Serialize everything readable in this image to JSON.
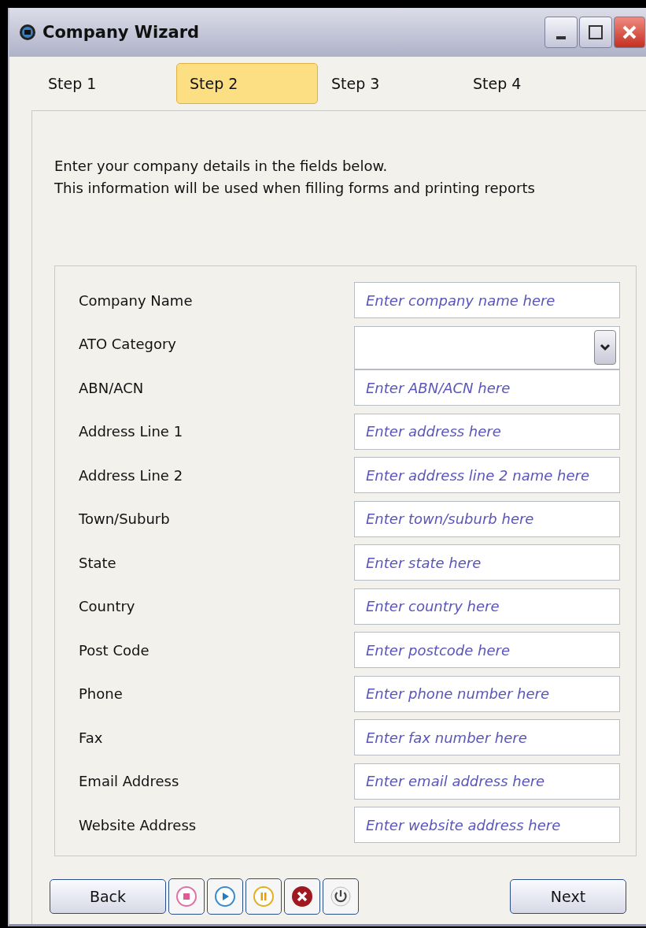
{
  "window": {
    "title": "Company Wizard"
  },
  "tabs": [
    {
      "label": "Step 1",
      "selected": false
    },
    {
      "label": "Step 2",
      "selected": true
    },
    {
      "label": "Step 3",
      "selected": false
    },
    {
      "label": "Step 4",
      "selected": false
    }
  ],
  "intro": [
    "Enter your company details in the fields below.",
    "This information will be used when filling forms and printing reports"
  ],
  "fields": [
    {
      "label": "Company Name",
      "kind": "text",
      "placeholder": "Enter company name here"
    },
    {
      "label": "ATO Category",
      "kind": "select"
    },
    {
      "label": "ABN/ACN",
      "kind": "text",
      "placeholder": "Enter ABN/ACN here"
    },
    {
      "label": "Address Line 1",
      "kind": "text",
      "placeholder": "Enter address here"
    },
    {
      "label": "Address Line 2",
      "kind": "text",
      "placeholder": "Enter address line 2 name here"
    },
    {
      "label": "Town/Suburb",
      "kind": "text",
      "placeholder": "Enter town/suburb here"
    },
    {
      "label": "State",
      "kind": "text",
      "placeholder": "Enter state here"
    },
    {
      "label": "Country",
      "kind": "text",
      "placeholder": "Enter country here"
    },
    {
      "label": "Post Code",
      "kind": "text",
      "placeholder": "Enter postcode here"
    },
    {
      "label": "Phone",
      "kind": "text",
      "placeholder": "Enter phone number here"
    },
    {
      "label": "Fax",
      "kind": "text",
      "placeholder": "Enter fax number here"
    },
    {
      "label": "Email Address",
      "kind": "text",
      "placeholder": "Enter email address here"
    },
    {
      "label": "Website Address",
      "kind": "text",
      "placeholder": "Enter website address here"
    }
  ],
  "back_button": "Back",
  "tool_buttons": [
    {
      "kind": "stop"
    },
    {
      "kind": "play"
    },
    {
      "kind": "pause"
    },
    {
      "kind": "error"
    },
    {
      "kind": "power"
    }
  ],
  "next_button": "Next"
}
